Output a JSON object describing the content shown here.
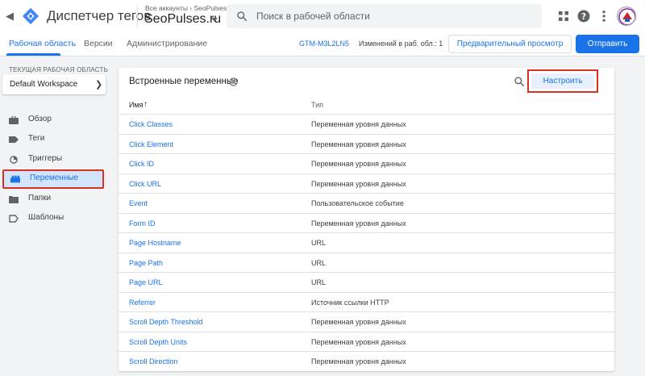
{
  "header": {
    "app_title": "Диспетчер тегов",
    "account_path": "Все аккаунты › SeoPulses",
    "container_name": "SeoPulses.ru",
    "search_placeholder": "Поиск в рабочей области"
  },
  "subnav": {
    "tabs": [
      {
        "label": "Рабочая область",
        "active": true
      },
      {
        "label": "Версии",
        "active": false
      },
      {
        "label": "Администрирование",
        "active": false
      }
    ],
    "container_id": "GTM-M3L2LN5",
    "changes": "Изменений в раб. обл.: 1",
    "preview_label": "Предварительный просмотр",
    "submit_label": "Отправить"
  },
  "sidebar": {
    "workspace_label": "ТЕКУЩАЯ РАБОЧАЯ ОБЛАСТЬ",
    "workspace_name": "Default Workspace",
    "items": [
      {
        "label": "Обзор",
        "icon": "briefcase-icon"
      },
      {
        "label": "Теги",
        "icon": "tag-icon"
      },
      {
        "label": "Триггеры",
        "icon": "trigger-icon"
      },
      {
        "label": "Переменные",
        "icon": "variables-icon",
        "active": true
      },
      {
        "label": "Папки",
        "icon": "folder-icon"
      },
      {
        "label": "Шаблоны",
        "icon": "template-icon"
      }
    ]
  },
  "main": {
    "title": "Встроенные переменные",
    "configure_label": "Настроить",
    "columns": {
      "name": "Имя",
      "type": "Тип"
    },
    "rows": [
      {
        "name": "Click Classes",
        "type": "Переменная уровня данных"
      },
      {
        "name": "Click Element",
        "type": "Переменная уровня данных"
      },
      {
        "name": "Click ID",
        "type": "Переменная уровня данных"
      },
      {
        "name": "Click URL",
        "type": "Переменная уровня данных"
      },
      {
        "name": "Event",
        "type": "Пользовательское событие"
      },
      {
        "name": "Form ID",
        "type": "Переменная уровня данных"
      },
      {
        "name": "Page Hostname",
        "type": "URL"
      },
      {
        "name": "Page Path",
        "type": "URL"
      },
      {
        "name": "Page URL",
        "type": "URL"
      },
      {
        "name": "Referrer",
        "type": "Источник ссылки HTTP"
      },
      {
        "name": "Scroll Depth Threshold",
        "type": "Переменная уровня данных"
      },
      {
        "name": "Scroll Depth Units",
        "type": "Переменная уровня данных"
      },
      {
        "name": "Scroll Direction",
        "type": "Переменная уровня данных"
      }
    ]
  },
  "colors": {
    "accent": "#1a73e8",
    "highlight_border": "#d93025",
    "active_nav_bg": "#d2e3fc"
  }
}
